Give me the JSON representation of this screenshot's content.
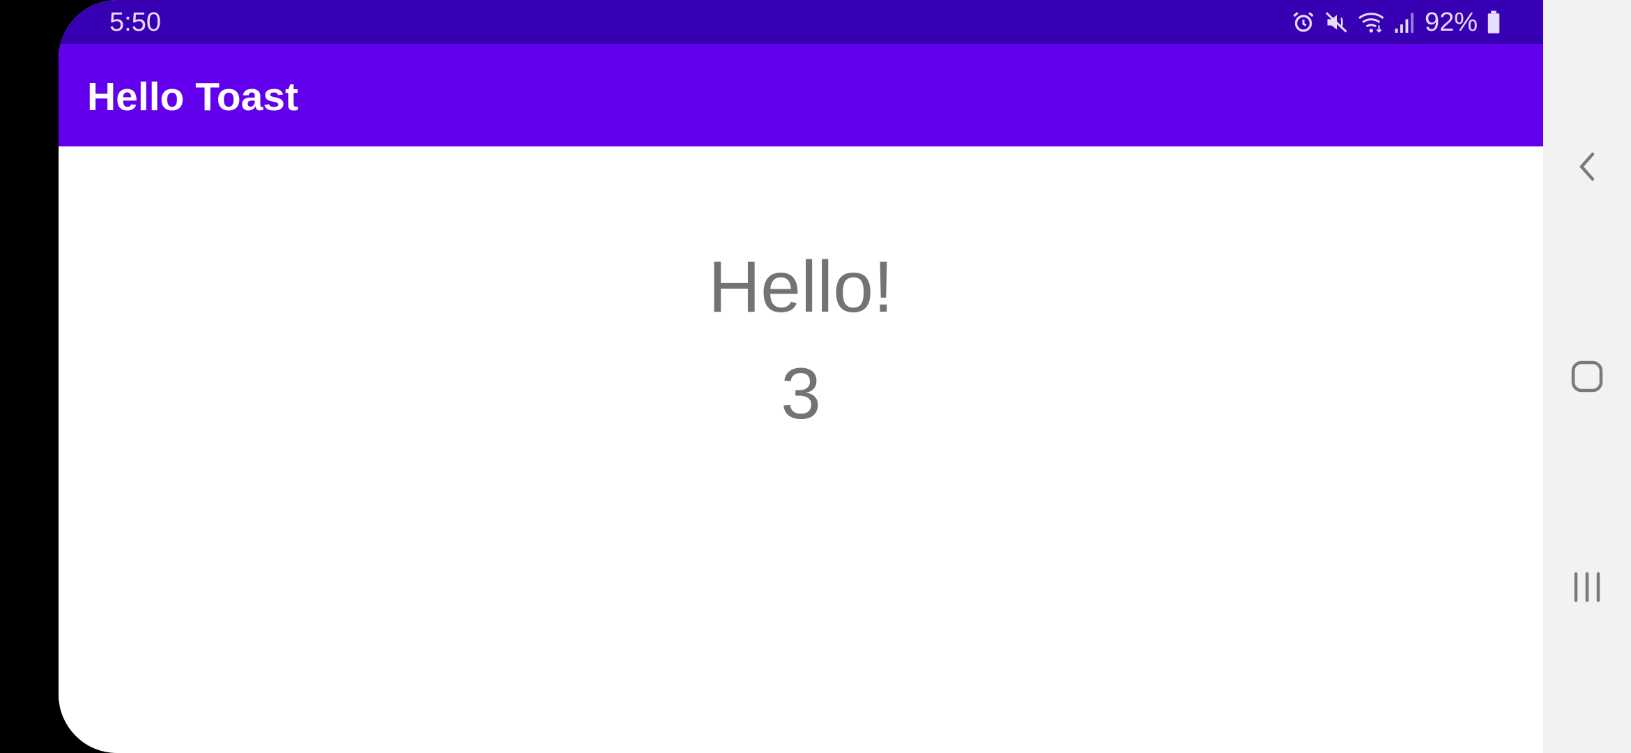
{
  "status_bar": {
    "time": "5:50",
    "battery_percent": "92%",
    "icons": [
      "alarm-icon",
      "mute-icon",
      "wifi-icon",
      "signal-icon",
      "battery-icon"
    ],
    "background_color": "#3700b3"
  },
  "app_bar": {
    "title": "Hello Toast",
    "background_color": "#6200ee"
  },
  "main": {
    "greeting": "Hello!",
    "count": "3",
    "text_color": "#737373"
  },
  "nav_bar": {
    "buttons": [
      "back-icon",
      "home-icon",
      "recents-icon"
    ]
  }
}
